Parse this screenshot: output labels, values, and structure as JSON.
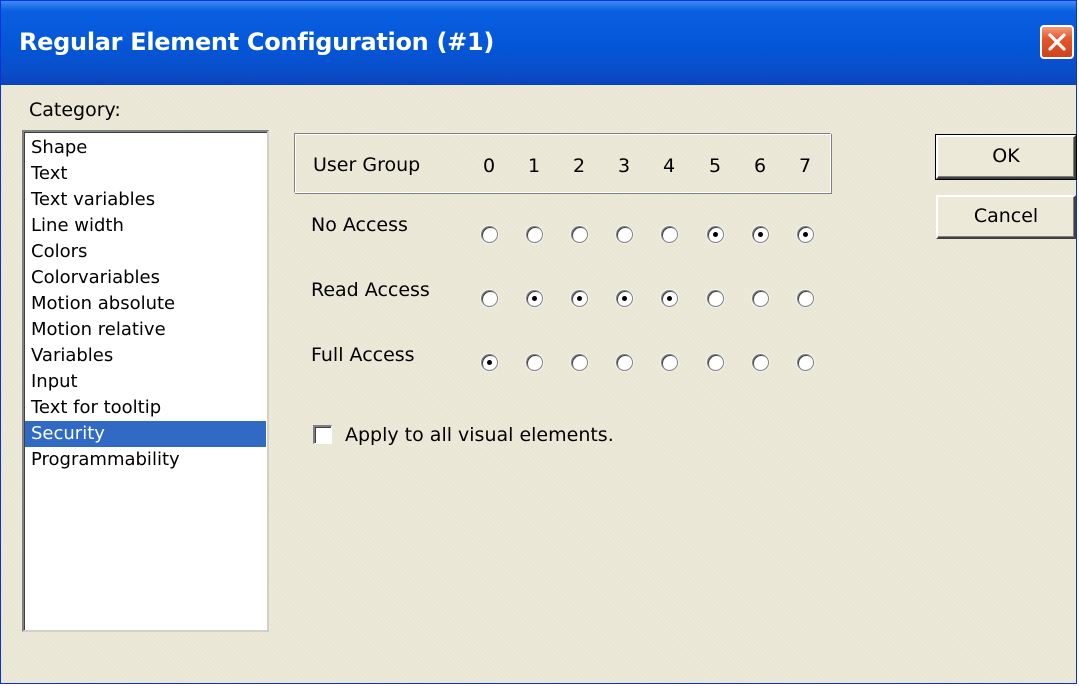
{
  "window": {
    "title": "Regular Element Configuration (#1)",
    "close_icon": "close-icon"
  },
  "category": {
    "label": "Category:",
    "items": [
      {
        "label": "Shape",
        "selected": false
      },
      {
        "label": "Text",
        "selected": false
      },
      {
        "label": "Text variables",
        "selected": false
      },
      {
        "label": "Line width",
        "selected": false
      },
      {
        "label": "Colors",
        "selected": false
      },
      {
        "label": "Colorvariables",
        "selected": false
      },
      {
        "label": "Motion absolute",
        "selected": false
      },
      {
        "label": "Motion relative",
        "selected": false
      },
      {
        "label": "Variables",
        "selected": false
      },
      {
        "label": "Input",
        "selected": false
      },
      {
        "label": "Text for tooltip",
        "selected": false
      },
      {
        "label": "Security",
        "selected": true
      },
      {
        "label": "Programmability",
        "selected": false
      }
    ]
  },
  "security": {
    "header_label": "User Group",
    "groups": [
      "0",
      "1",
      "2",
      "3",
      "4",
      "5",
      "6",
      "7"
    ],
    "rows": [
      {
        "label": "No Access",
        "checked": [
          false,
          false,
          false,
          false,
          false,
          true,
          true,
          true
        ]
      },
      {
        "label": "Read Access",
        "checked": [
          false,
          true,
          true,
          true,
          true,
          false,
          false,
          false
        ]
      },
      {
        "label": "Full Access",
        "checked": [
          true,
          false,
          false,
          false,
          false,
          false,
          false,
          false
        ]
      }
    ],
    "apply_all_label": "Apply to all visual elements.",
    "apply_all_checked": false
  },
  "buttons": {
    "ok_label": "OK",
    "cancel_label": "Cancel"
  },
  "colors": {
    "titlebar": "#0356d8",
    "selection": "#316ac5",
    "dialog_bg": "#ece9d8",
    "close_button": "#e2572d"
  }
}
